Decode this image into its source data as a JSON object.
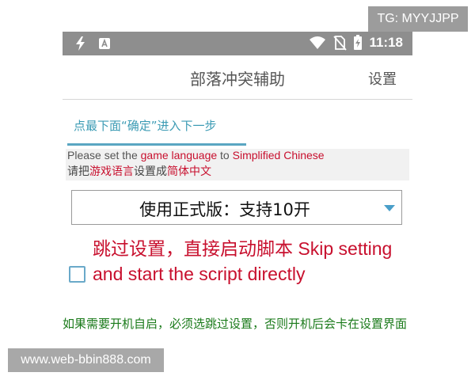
{
  "overlay": {
    "tg_handle": "TG: MYYJJPP",
    "watermark": "www.web-bbin888.com"
  },
  "status_bar": {
    "time": "11:18",
    "icons_left": [
      "lightning-icon",
      "app-a-icon"
    ],
    "icons_right": [
      "wifi-icon",
      "no-sim-icon",
      "battery-charging-icon"
    ]
  },
  "app_bar": {
    "title": "部落冲突辅助",
    "settings_label": "设置"
  },
  "tab": {
    "label": "点最下面“确定”进入下一步"
  },
  "language_notice": {
    "en_prefix": "Please set the ",
    "en_highlight1": "game language",
    "en_mid": " to ",
    "en_highlight2": "Simplified Chinese",
    "zh_prefix": "请把",
    "zh_highlight1": "游戏语言",
    "zh_mid": "设置成",
    "zh_highlight2": "简体中文"
  },
  "version_select": {
    "selected": "使用正式版：支持10开"
  },
  "skip": {
    "checked": false,
    "label": "跳过设置，直接启动脚本 Skip setting and start the script directly"
  },
  "note": "如果需要开机自启，必须选跳过设置，否则开机后会卡在设置界面",
  "colors": {
    "accent_blue": "#3c9bb4",
    "warning_red": "#c8102e",
    "note_green": "#1a7a1a",
    "status_bar_gray": "#8e8e8e"
  }
}
